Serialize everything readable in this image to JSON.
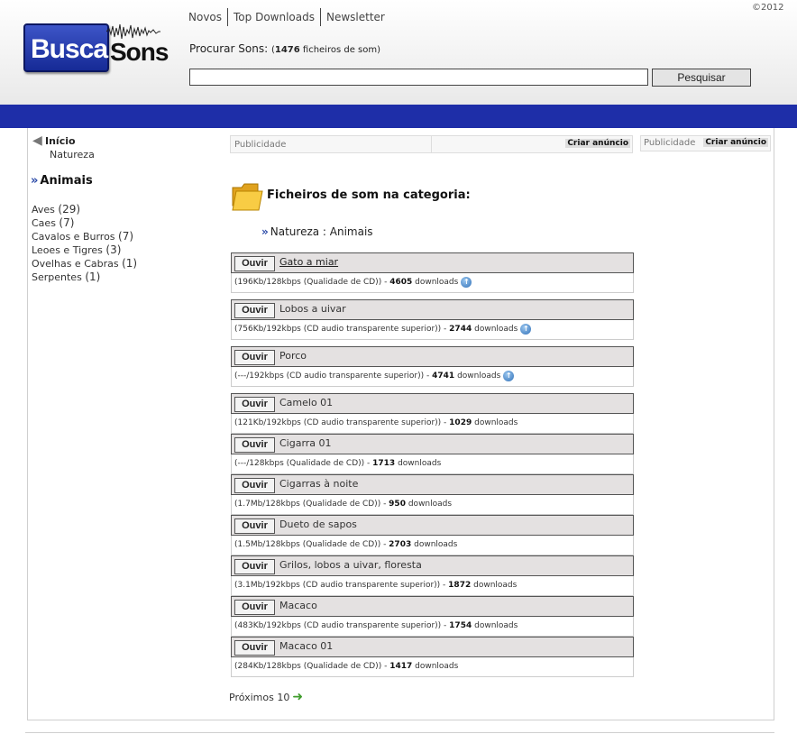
{
  "header": {
    "logo_part1": "Busca",
    "logo_part2": "Sons",
    "copyright": "©2012",
    "nav": [
      "Novos",
      "Top Downloads",
      "Newsletter"
    ],
    "search_label": "Procurar Sons:",
    "search_count_open": "(",
    "search_count": "1476",
    "search_count_suffix": " ficheiros de som)",
    "search_value": "",
    "search_button": "Pesquisar"
  },
  "sidebar": {
    "home": "Início",
    "sub": "Natureza",
    "category": "Animais",
    "items": [
      {
        "label": "Aves",
        "count": "(29)"
      },
      {
        "label": "Caes",
        "count": "(7)"
      },
      {
        "label": "Cavalos e Burros",
        "count": "(7)"
      },
      {
        "label": "Leoes e Tigres",
        "count": "(3)"
      },
      {
        "label": "Ovelhas e Cabras",
        "count": "(1)"
      },
      {
        "label": "Serpentes",
        "count": "(1)"
      }
    ]
  },
  "ads": {
    "label": "Publicidade",
    "button": "Criar anúncio"
  },
  "main": {
    "heading": "Ficheiros de som na categoria:",
    "path": "Natureza : Animais",
    "play_label": "Ouvir",
    "downloads_word": "downloads",
    "next": "Próximos 10",
    "sounds": [
      {
        "name": "Gato a miar",
        "meta": "(196Kb/128kbps (Qualidade de CD)) - ",
        "downloads": "4605",
        "up": true
      },
      {
        "name": "Lobos a uivar",
        "meta": "(756Kb/192kbps (CD audio transparente superior)) - ",
        "downloads": "2744",
        "up": true
      },
      {
        "name": "Porco",
        "meta": "(---/192kbps (CD audio transparente superior)) - ",
        "downloads": "4741",
        "up": true
      },
      {
        "name": "Camelo 01",
        "meta": "(121Kb/192kbps (CD audio transparente superior)) - ",
        "downloads": "1029",
        "up": false
      },
      {
        "name": "Cigarra 01",
        "meta": "(---/128kbps (Qualidade de CD)) - ",
        "downloads": "1713",
        "up": false
      },
      {
        "name": "Cigarras à noite",
        "meta": "(1.7Mb/128kbps (Qualidade de CD)) - ",
        "downloads": "950",
        "up": false
      },
      {
        "name": "Dueto de sapos",
        "meta": "(1.5Mb/128kbps (Qualidade de CD)) - ",
        "downloads": "2703",
        "up": false
      },
      {
        "name": "Grilos, lobos a uivar, floresta",
        "meta": "(3.1Mb/192kbps (CD audio transparente superior)) - ",
        "downloads": "1872",
        "up": false
      },
      {
        "name": "Macaco",
        "meta": "(483Kb/192kbps (CD audio transparente superior)) - ",
        "downloads": "1754",
        "up": false
      },
      {
        "name": "Macaco 01",
        "meta": "(284Kb/128kbps (Qualidade de CD)) - ",
        "downloads": "1417",
        "up": false
      }
    ]
  }
}
